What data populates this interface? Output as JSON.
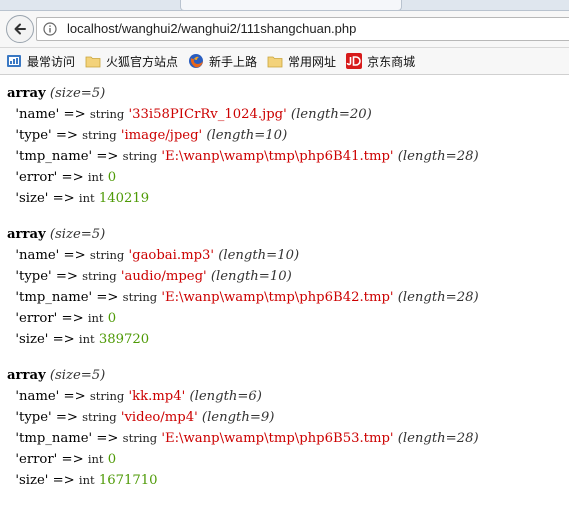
{
  "browser": {
    "url": "localhost/wanghui2/wanghui2/111shangchuan.php",
    "bookmarks": [
      "最常访问",
      "火狐官方站点",
      "新手上路",
      "常用网址",
      "京东商城"
    ]
  },
  "dump": {
    "arrays": [
      {
        "header": "array",
        "size": "(size=5)",
        "name": {
          "key": "'name'",
          "arrow": "=>",
          "type": "string",
          "value": "'33i58PICrRv_1024.jpg'",
          "len": "(length=20)"
        },
        "mtype": {
          "key": "'type'",
          "arrow": "=>",
          "type": "string",
          "value": "'image/jpeg'",
          "len": "(length=10)"
        },
        "tmp": {
          "key": "'tmp_name'",
          "arrow": "=>",
          "type": "string",
          "value": "'E:\\wanp\\wamp\\tmp\\php6B41.tmp'",
          "len": "(length=28)"
        },
        "error": {
          "key": "'error'",
          "arrow": "=>",
          "type": "int",
          "value": "0"
        },
        "fsize": {
          "key": "'size'",
          "arrow": "=>",
          "type": "int",
          "value": "140219"
        }
      },
      {
        "header": "array",
        "size": "(size=5)",
        "name": {
          "key": "'name'",
          "arrow": "=>",
          "type": "string",
          "value": "'gaobai.mp3'",
          "len": "(length=10)"
        },
        "mtype": {
          "key": "'type'",
          "arrow": "=>",
          "type": "string",
          "value": "'audio/mpeg'",
          "len": "(length=10)"
        },
        "tmp": {
          "key": "'tmp_name'",
          "arrow": "=>",
          "type": "string",
          "value": "'E:\\wanp\\wamp\\tmp\\php6B42.tmp'",
          "len": "(length=28)"
        },
        "error": {
          "key": "'error'",
          "arrow": "=>",
          "type": "int",
          "value": "0"
        },
        "fsize": {
          "key": "'size'",
          "arrow": "=>",
          "type": "int",
          "value": "389720"
        }
      },
      {
        "header": "array",
        "size": "(size=5)",
        "name": {
          "key": "'name'",
          "arrow": "=>",
          "type": "string",
          "value": "'kk.mp4'",
          "len": "(length=6)"
        },
        "mtype": {
          "key": "'type'",
          "arrow": "=>",
          "type": "string",
          "value": "'video/mp4'",
          "len": "(length=9)"
        },
        "tmp": {
          "key": "'tmp_name'",
          "arrow": "=>",
          "type": "string",
          "value": "'E:\\wanp\\wamp\\tmp\\php6B53.tmp'",
          "len": "(length=28)"
        },
        "error": {
          "key": "'error'",
          "arrow": "=>",
          "type": "int",
          "value": "0"
        },
        "fsize": {
          "key": "'size'",
          "arrow": "=>",
          "type": "int",
          "value": "1671710"
        }
      }
    ]
  }
}
